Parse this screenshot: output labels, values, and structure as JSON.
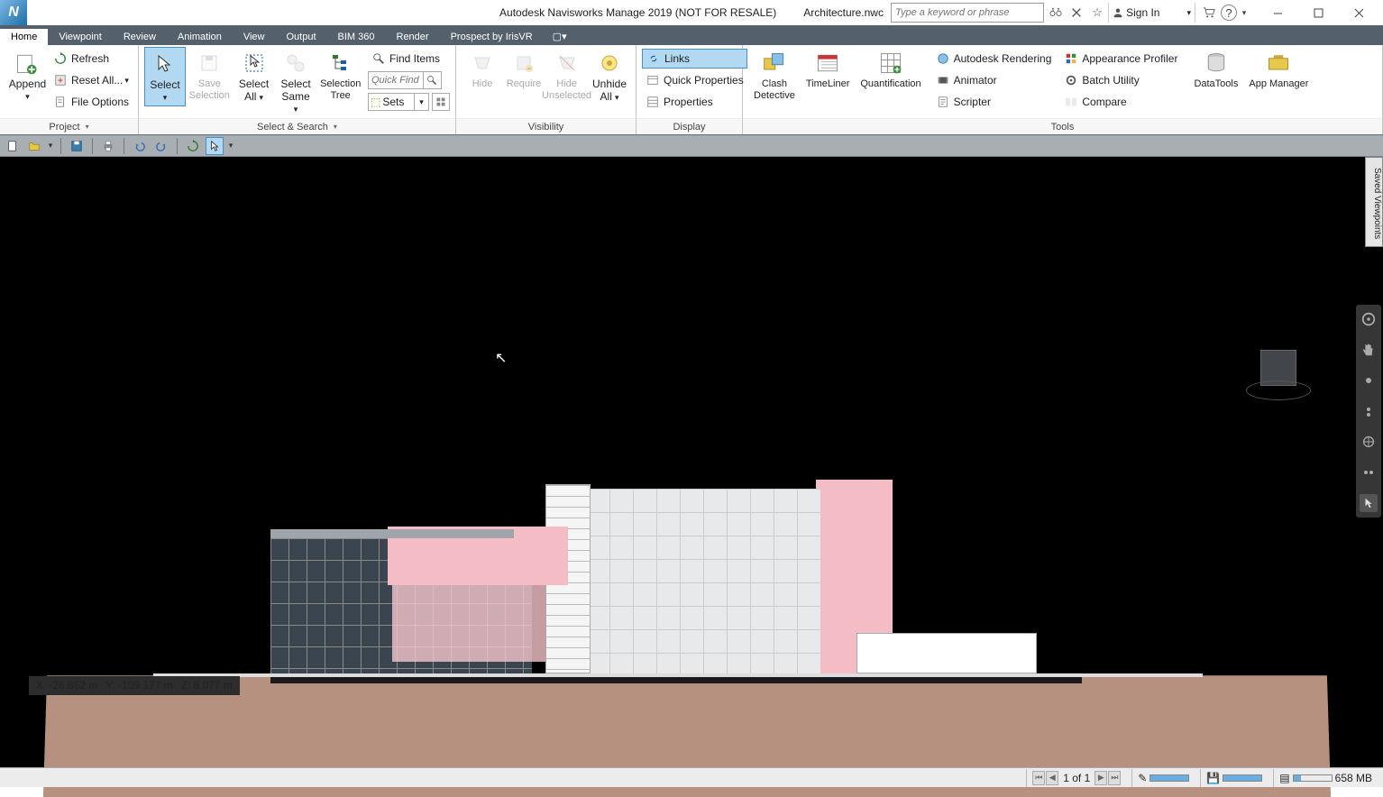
{
  "title": {
    "app": "Autodesk Navisworks Manage 2019 (NOT FOR RESALE)",
    "file": "Architecture.nwc"
  },
  "search": {
    "placeholder": "Type a keyword or phrase"
  },
  "signin": {
    "label": "Sign In"
  },
  "tabs": {
    "items": [
      "Home",
      "Viewpoint",
      "Review",
      "Animation",
      "View",
      "Output",
      "BIM 360",
      "Render",
      "Prospect by IrisVR"
    ],
    "active": 0
  },
  "ribbon": {
    "project": {
      "append": "Append",
      "refresh": "Refresh",
      "reset_all": "Reset All...",
      "file_options": "File Options",
      "panel": "Project"
    },
    "select": {
      "select": "Select",
      "save_selection": "Save\nSelection",
      "select_all": "Select\nAll",
      "select_same": "Select\nSame",
      "selection_tree": "Selection\nTree",
      "find_items": "Find Items",
      "quick_find_placeholder": "Quick Find",
      "sets": "Sets",
      "panel": "Select & Search"
    },
    "visibility": {
      "hide": "Hide",
      "require": "Require",
      "hide_unselected": "Hide\nUnselected",
      "unhide_all": "Unhide\nAll",
      "panel": "Visibility"
    },
    "display": {
      "links": "Links",
      "quick_properties": "Quick Properties",
      "properties": "Properties",
      "panel": "Display"
    },
    "tools": {
      "clash": "Clash\nDetective",
      "timeliner": "TimeLiner",
      "quantification": "Quantification",
      "autodesk_rendering": "Autodesk Rendering",
      "animator": "Animator",
      "scripter": "Scripter",
      "appearance_profiler": "Appearance Profiler",
      "batch_utility": "Batch Utility",
      "compare": "Compare",
      "datatools": "DataTools",
      "app_manager": "App Manager",
      "panel": "Tools"
    }
  },
  "right_tab": "Saved Viewpoints",
  "coords": {
    "x_label": "X:",
    "x": "-26.862 m",
    "y_label": "Y:",
    "y": "-109.177 m",
    "z_label": "Z:",
    "z": "8.077 m"
  },
  "status": {
    "page": "1 of 1",
    "mem": "658 MB"
  }
}
